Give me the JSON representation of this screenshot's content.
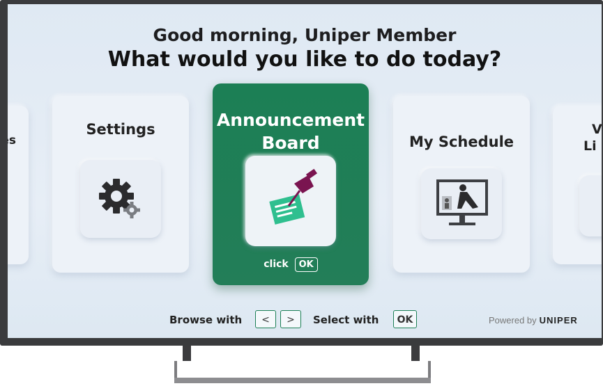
{
  "header": {
    "greeting": "Good morning, Uniper Member",
    "question": "What would you like to do today?"
  },
  "cards": {
    "left_partial": "es",
    "settings": {
      "label": "Settings",
      "icon": "gear-icon"
    },
    "announcement": {
      "label_line1": "Announcement",
      "label_line2": "Board",
      "icon": "pushpin-note-icon",
      "click_label": "click",
      "ok_label": "OK"
    },
    "schedule": {
      "label": "My Schedule",
      "icon": "monitor-exercise-icon"
    },
    "right_partial_line1": "V",
    "right_partial_line2": "Li"
  },
  "bottom": {
    "browse_label": "Browse with",
    "prev_key": "<",
    "next_key": ">",
    "select_label": "Select with",
    "select_key": "OK",
    "powered_by": "Powered by",
    "brand": "UNIPER"
  },
  "colors": {
    "accent_green": "#1c7f55",
    "pin": "#7a1450",
    "note": "#2fbf8f"
  }
}
